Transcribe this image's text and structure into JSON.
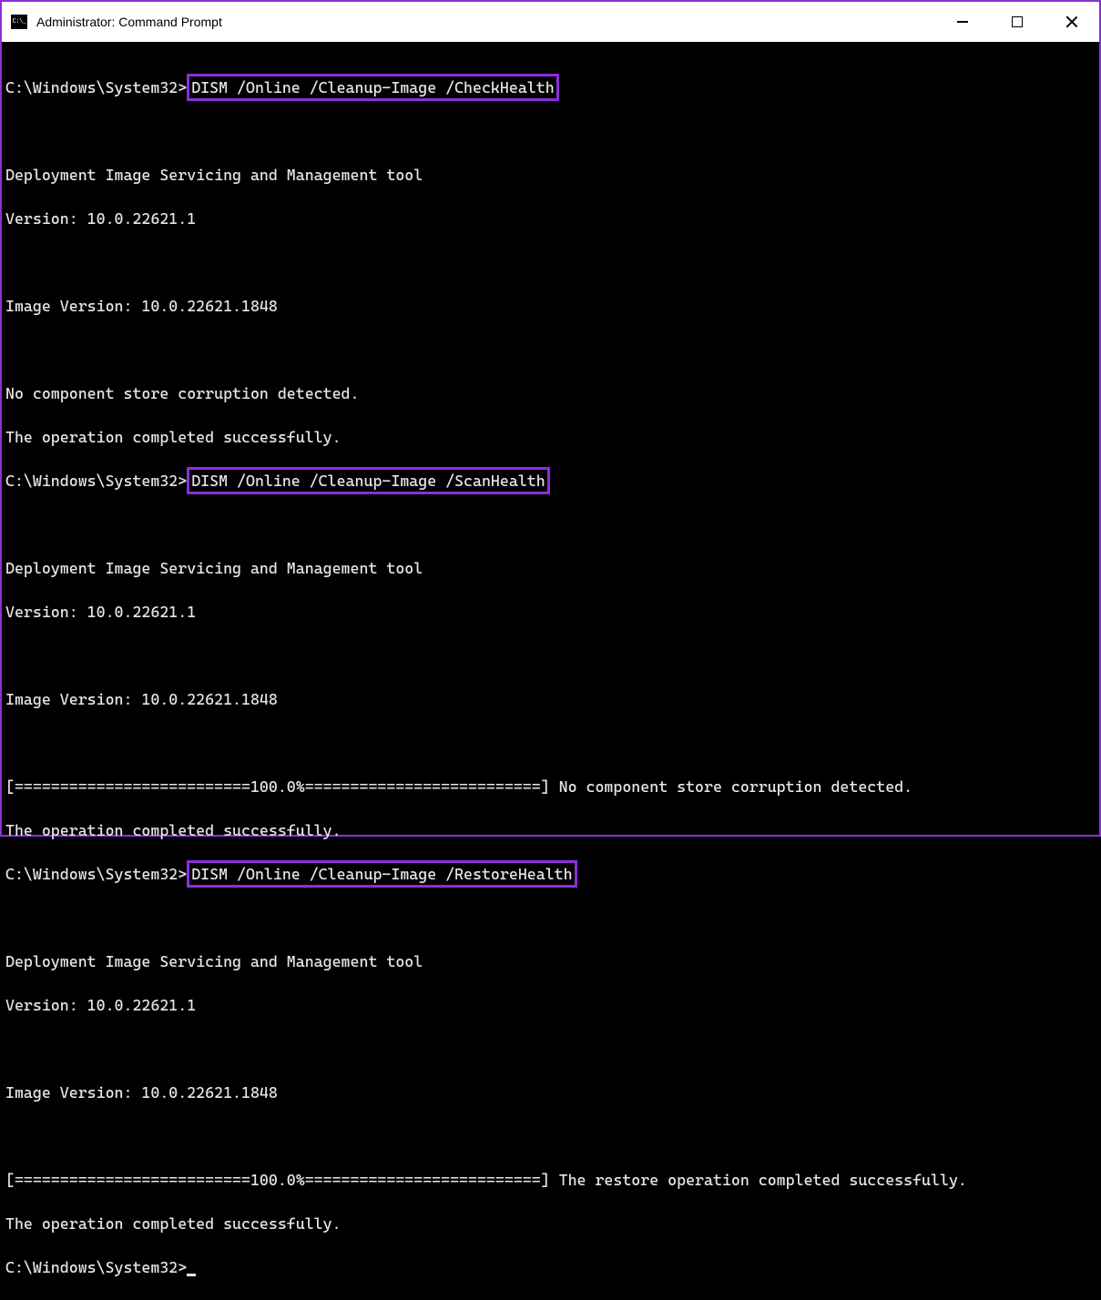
{
  "window": {
    "title": "Administrator: Command Prompt"
  },
  "terminal": {
    "prompt": "C:\\Windows\\System32>",
    "blocks": [
      {
        "command": "DISM /Online /Cleanup-Image /CheckHealth",
        "output": [
          "",
          "Deployment Image Servicing and Management tool",
          "Version: 10.0.22621.1",
          "",
          "Image Version: 10.0.22621.1848",
          "",
          "No component store corruption detected.",
          "The operation completed successfully."
        ]
      },
      {
        "command": "DISM /Online /Cleanup-Image /ScanHealth",
        "output": [
          "",
          "Deployment Image Servicing and Management tool",
          "Version: 10.0.22621.1",
          "",
          "Image Version: 10.0.22621.1848",
          "",
          "[==========================100.0%==========================] No component store corruption detected.",
          "The operation completed successfully."
        ]
      },
      {
        "command": "DISM /Online /Cleanup-Image /RestoreHealth",
        "output": [
          "",
          "Deployment Image Servicing and Management tool",
          "Version: 10.0.22621.1",
          "",
          "Image Version: 10.0.22621.1848",
          "",
          "[==========================100.0%==========================] The restore operation completed successfully.",
          "The operation completed successfully."
        ]
      }
    ]
  }
}
